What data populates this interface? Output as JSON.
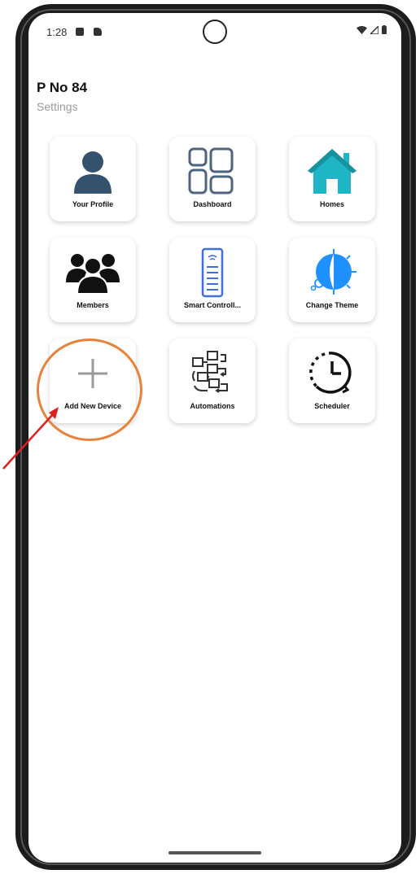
{
  "status_bar": {
    "time": "1:28"
  },
  "header": {
    "title": "P No 84",
    "subtitle": "Settings"
  },
  "tiles": [
    {
      "label": "Your Profile",
      "icon": "profile-icon"
    },
    {
      "label": "Dashboard",
      "icon": "dashboard-icon"
    },
    {
      "label": "Homes",
      "icon": "home-icon"
    },
    {
      "label": "Members",
      "icon": "members-icon"
    },
    {
      "label": "Smart Controll...",
      "icon": "smart-controller-icon"
    },
    {
      "label": "Change Theme",
      "icon": "theme-icon"
    },
    {
      "label": "Add New Device",
      "icon": "plus-icon"
    },
    {
      "label": "Automations",
      "icon": "automations-icon"
    },
    {
      "label": "Scheduler",
      "icon": "scheduler-icon"
    }
  ],
  "colors": {
    "accent_orange": "#e8823a",
    "arrow_red": "#e02020",
    "profile_blue": "#34516e",
    "home_teal": "#1eb6c6",
    "theme_blue": "#1e90ff"
  }
}
